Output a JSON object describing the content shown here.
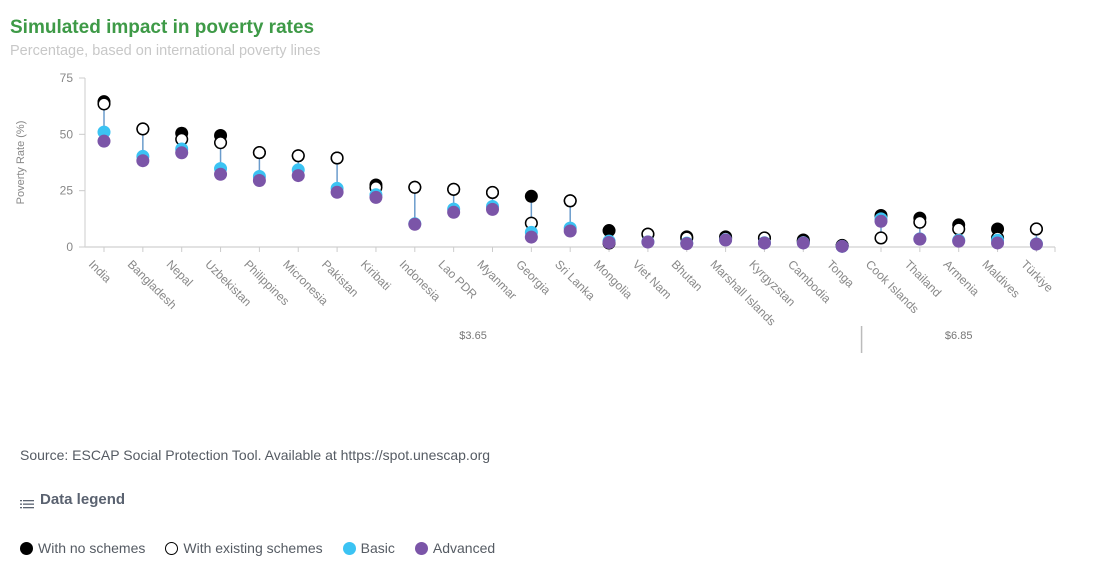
{
  "header": {
    "title": "Simulated impact in poverty rates",
    "subtitle": "Percentage, based on international poverty lines"
  },
  "footer": {
    "source": "Source: ESCAP Social Protection Tool. Available at https://spot.unescap.org",
    "legend_title": "Data legend",
    "legend_icon": "list-icon"
  },
  "colors": {
    "no_schemes": "#000000",
    "existing_schemes": "#ffffff",
    "basic": "#3bc3f3",
    "advanced": "#7b55a8",
    "connector": "#6b9ccc",
    "title": "#3e9a47"
  },
  "legend": [
    {
      "key": "no_schemes",
      "label": "With no schemes"
    },
    {
      "key": "existing_schemes",
      "label": "With existing schemes"
    },
    {
      "key": "basic",
      "label": "Basic"
    },
    {
      "key": "advanced",
      "label": "Advanced"
    }
  ],
  "chart_data": {
    "type": "scatter",
    "title": "Simulated impact in poverty rates",
    "subtitle": "Percentage, based on international poverty lines",
    "xlabel": "",
    "ylabel": "Poverty Rate (%)",
    "ylim": [
      0,
      75
    ],
    "yticks": [
      0,
      25,
      50,
      75
    ],
    "grid": false,
    "legend_position": "bottom-left",
    "categories": [
      "India",
      "Bangladesh",
      "Nepal",
      "Uzbekistan",
      "Philippines",
      "Micronesia",
      "Pakistan",
      "Kiribati",
      "Indonesia",
      "Lao PDR",
      "Myanmar",
      "Georgia",
      "Sri Lanka",
      "Mongolia",
      "Viet Nam",
      "Bhutan",
      "Marshall Islands",
      "Kyrgyzstan",
      "Cambodia",
      "Tonga",
      "Cook Islands",
      "Thailand",
      "Armenia",
      "Maldives",
      "Türkiye"
    ],
    "groups": [
      {
        "label": "$3.65",
        "from": 0,
        "to": 19
      },
      {
        "label": "$6.85",
        "from": 20,
        "to": 24
      }
    ],
    "series": [
      {
        "key": "no_schemes",
        "name": "With no schemes",
        "values": [
          64.5,
          52.4,
          50.5,
          49.5,
          41.9,
          40.5,
          39.5,
          27.5,
          26.5,
          25.6,
          24.2,
          22.5,
          20.5,
          7.3,
          5.7,
          4.5,
          4.5,
          4.0,
          3.1,
          0.7,
          14.0,
          12.8,
          9.8,
          8.0,
          8.0
        ]
      },
      {
        "key": "existing_schemes",
        "name": "With existing schemes",
        "values": [
          63.5,
          52.4,
          47.8,
          46.3,
          41.9,
          40.5,
          39.5,
          26.4,
          26.5,
          25.6,
          24.2,
          10.6,
          20.5,
          1.8,
          5.7,
          4.0,
          4.0,
          4.0,
          2.6,
          0.6,
          4.0,
          11.0,
          8.0,
          4.0,
          8.0
        ]
      },
      {
        "key": "basic",
        "name": "Basic",
        "values": [
          51.0,
          40.2,
          43.5,
          34.8,
          31.3,
          34.2,
          26.0,
          23.2,
          10.3,
          16.8,
          18.0,
          6.5,
          8.4,
          2.6,
          2.3,
          1.7,
          3.2,
          1.9,
          1.9,
          0.3,
          12.5,
          3.6,
          3.0,
          3.0,
          1.4
        ]
      },
      {
        "key": "advanced",
        "name": "Advanced",
        "values": [
          47.0,
          38.3,
          41.8,
          32.3,
          29.5,
          31.7,
          24.3,
          22.0,
          10.1,
          15.4,
          16.7,
          4.4,
          7.1,
          2.0,
          2.2,
          1.5,
          3.1,
          1.8,
          1.8,
          0.3,
          11.4,
          3.5,
          2.6,
          1.8,
          1.3
        ]
      }
    ]
  }
}
